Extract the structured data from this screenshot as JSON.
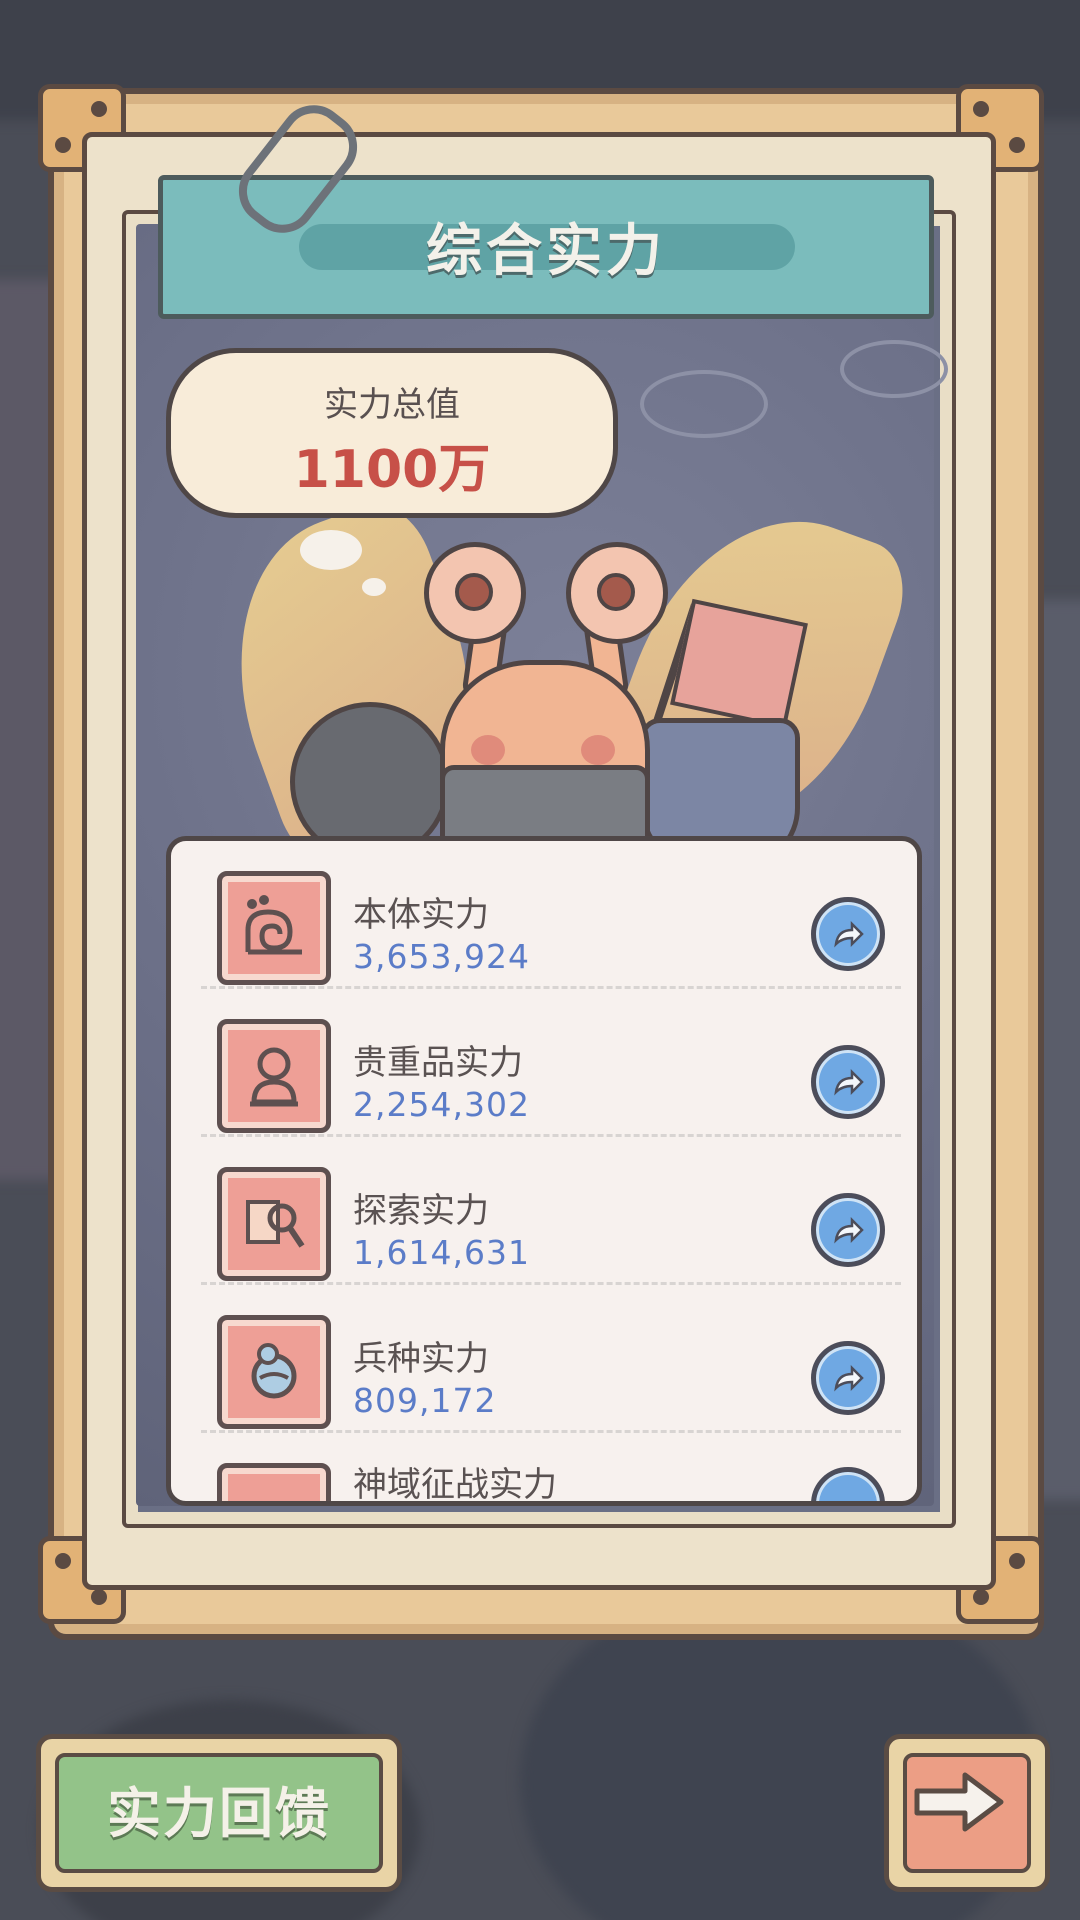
{
  "title": "综合实力",
  "total": {
    "label": "实力总值",
    "value": "1100万"
  },
  "stats": [
    {
      "name": "本体实力",
      "value": "3,653,924",
      "icon": "snail-icon"
    },
    {
      "name": "贵重品实力",
      "value": "2,254,302",
      "icon": "bust-statue-icon"
    },
    {
      "name": "探索实力",
      "value": "1,614,631",
      "icon": "magnifier-map-icon"
    },
    {
      "name": "兵种实力",
      "value": "809,172",
      "icon": "troop-orb-icon"
    },
    {
      "name": "神域征战实力",
      "value": "",
      "icon": "unknown-icon"
    }
  ],
  "buttons": {
    "feedback": "实力回馈",
    "next_icon": "arrow-right-icon",
    "go_icon": "share-arrow-icon"
  },
  "colors": {
    "banner": "#7bbcbc",
    "total_value": "#c75048",
    "stat_value": "#5b7cc8",
    "icon_bg": "#ee9f96",
    "go_button": "#6fa8e3",
    "feedback_button": "#93c389",
    "next_button": "#ec9e85"
  }
}
